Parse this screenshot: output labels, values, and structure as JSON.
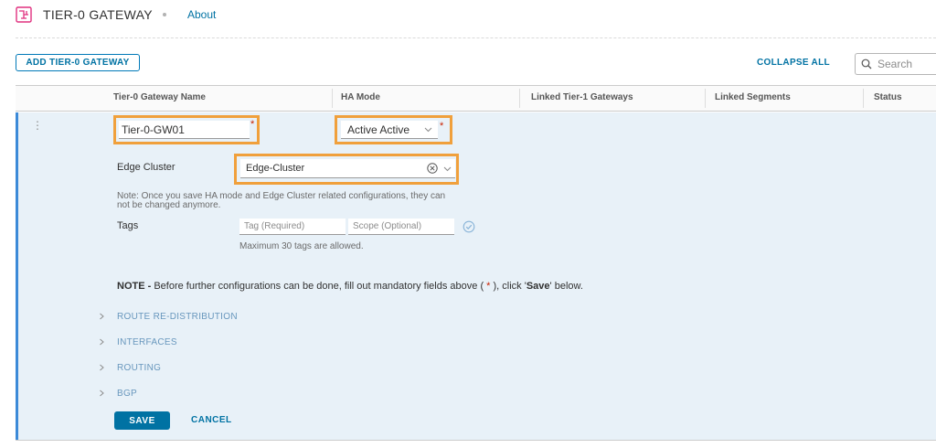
{
  "header": {
    "title": "TIER-0 GATEWAY",
    "about_link": "About",
    "brand_color": "#e0317f"
  },
  "toolbar": {
    "add_button": "ADD TIER-0 GATEWAY",
    "collapse_all": "COLLAPSE ALL",
    "search_placeholder": "Search"
  },
  "table": {
    "columns": [
      "Tier-0 Gateway Name",
      "HA Mode",
      "Linked Tier-1 Gateways",
      "Linked Segments",
      "Status"
    ]
  },
  "form": {
    "name_value": "Tier-0-GW01",
    "required_marker": "*",
    "ha_mode": {
      "value": "Active Active"
    },
    "edge_cluster": {
      "label": "Edge Cluster",
      "value": "Edge-Cluster"
    },
    "note_small": "Note: Once you save HA mode and Edge Cluster related configurations, they can not be changed anymore.",
    "tags": {
      "label": "Tags",
      "tag_placeholder": "Tag (Required)",
      "scope_placeholder": "Scope (Optional)",
      "hint": "Maximum 30 tags are allowed."
    },
    "note_main": {
      "prefix": "NOTE -",
      "text_before": " Before further configurations can be done, fill out mandatory fields above ( ",
      "marker": "*",
      "text_middle": " ), click '",
      "save_word": "Save",
      "text_after": "' below."
    },
    "sections": [
      "ROUTE RE-DISTRIBUTION",
      "INTERFACES",
      "ROUTING",
      "BGP"
    ],
    "save_button": "SAVE",
    "cancel_button": "CANCEL"
  },
  "colors": {
    "accent": "#0072a3",
    "highlight": "#f0a03c",
    "required": "#c92100",
    "row_background": "#e8f1f8"
  }
}
